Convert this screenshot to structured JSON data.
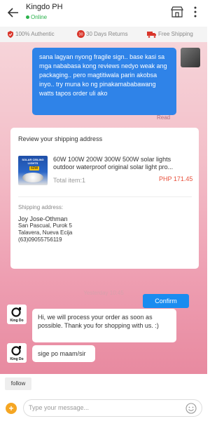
{
  "header": {
    "shop_name": "Kingdo PH",
    "status": "Online"
  },
  "trust_bar": {
    "authentic": "100% Authentic",
    "returns": "30 Days Returns",
    "shipping": "Free Shipping",
    "returns_badge": "30"
  },
  "messages": {
    "outgoing_text": "sana lagyan nyong fragile sign.. base kasi sa mga nababasa kong reviews nedyo weak ang packaging.. pero magtitiwala parin akobsa inyo.. try muna ko ng pinakamababawang watts tapos order uli ako",
    "read_label": "Read",
    "timestamp": "Yesterday 10:45",
    "reply_1": "Hi, we will process your order as soon as possible. Thank you for shopping with us. :)",
    "reply_2": "sige po maam/sir"
  },
  "order_card": {
    "title": "Review your shipping address",
    "product_name": "60W 100W 200W 300W 500W solar lights outdoor waterproof original solar light pro...",
    "total_items": "Total item:1",
    "price": "PHP 171.45",
    "image_title": "SOLAR CEILING LIGHTS",
    "image_badge": "60W",
    "shipping_label": "Shipping address:",
    "address": {
      "name": "Joy Jose-Othman",
      "line1": "San Pascual, Purok 5",
      "line2": "Talavera, Nueva Ecija",
      "phone": "(63)09055756119"
    },
    "confirm_label": "Confirm"
  },
  "shop_avatar": {
    "label": "King Do"
  },
  "bottom_bar": {
    "follow_label": "follow",
    "input_placeholder": "Type your message..."
  },
  "colors": {
    "accent_blue": "#2f83e8",
    "online_green": "#2bb24c",
    "price_red": "#e8513c",
    "plus_orange": "#f5a623"
  }
}
